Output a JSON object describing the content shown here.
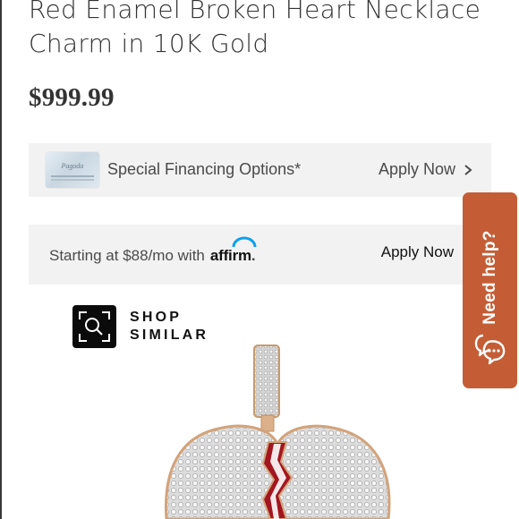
{
  "product": {
    "title": "Red Enamel Broken Heart Necklace Charm in 10K Gold",
    "price": "$999.99",
    "image_alt_icon": "broken-heart-pendant"
  },
  "financing": {
    "card_brand": "Pagoda",
    "label": "Special Financing Options*",
    "apply_label": "Apply Now"
  },
  "affirm": {
    "text": "Starting at $88/mo with",
    "logo_text": "affirm",
    "logo_suffix": ".",
    "apply_label": "Apply Now"
  },
  "shop_similar": {
    "line1": "SHOP",
    "line2": "SIMILAR",
    "icon": "camera-search-icon"
  },
  "help": {
    "label": "Need help?",
    "icon": "chat-bubbles-icon",
    "color": "#c45d36"
  },
  "colors": {
    "text": "#333333",
    "panel_bg": "#f2f2f2",
    "enamel_red": "#a3151f",
    "gold": "#d9a676"
  }
}
